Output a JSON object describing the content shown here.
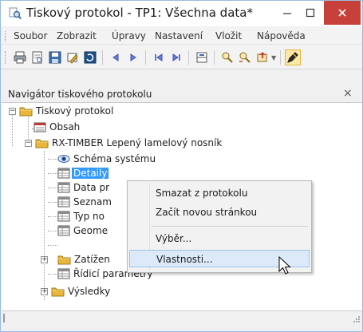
{
  "window": {
    "title": "Tiskový protokol - TP1: Všechna data*",
    "minimize_icon": "minimize-icon",
    "maximize_icon": "maximize-icon",
    "close_icon": "close-icon",
    "close_color": "#c7413a"
  },
  "menubar": {
    "items": [
      "Soubor",
      "Zobrazit",
      "Úpravy",
      "Nastavení",
      "Vložit",
      "Nápověda"
    ]
  },
  "toolbar": {
    "buttons": [
      "print-icon",
      "print-preview-icon",
      "save-icon",
      "tools-icon",
      "refresh-icon",
      "prev-icon",
      "next-icon",
      "first-icon",
      "last-icon",
      "page-setup-icon",
      "search-icon",
      "search-next-icon",
      "export-icon",
      "pen-icon"
    ]
  },
  "navigator": {
    "title": "Navigátor tiskového protokolu",
    "close_glyph": "×",
    "tree": [
      {
        "label": "Tiskový protokol",
        "icon": "folder-icon",
        "level": 0,
        "expander": "−"
      },
      {
        "label": "Obsah",
        "icon": "toc-icon",
        "level": 1
      },
      {
        "label": "RX-TIMBER Lepený lamelový nosník",
        "icon": "folder-icon",
        "level": 1,
        "expander": "−"
      },
      {
        "label": "Schéma systému",
        "icon": "eye-icon",
        "level": 2
      },
      {
        "label": "Detaily",
        "icon": "table-icon",
        "level": 2,
        "selected": true
      },
      {
        "label": "Data pr",
        "icon": "table-icon",
        "level": 2
      },
      {
        "label": "Seznam",
        "icon": "table-icon",
        "level": 2
      },
      {
        "label": "Typ no",
        "icon": "table-icon",
        "level": 2
      },
      {
        "label": "Geome",
        "icon": "table-icon",
        "level": 2
      },
      {
        "label": "Zatížen",
        "icon": "folder-icon",
        "level": 2,
        "expander": "+"
      },
      {
        "label": "Řídicí parametry",
        "icon": "table-icon",
        "level": 2
      },
      {
        "label": "Výsledky",
        "icon": "folder-icon",
        "level": 2,
        "expander": "+"
      }
    ]
  },
  "context_menu": {
    "items": [
      {
        "label": "Smazat z protokolu"
      },
      {
        "label": "Začít novou stránkou"
      },
      {
        "label": "Výběr..."
      },
      {
        "label": "Vlastnosti...",
        "hovered": true
      }
    ],
    "hover_color": "#dbe9f8"
  },
  "accent": "#3399ff"
}
